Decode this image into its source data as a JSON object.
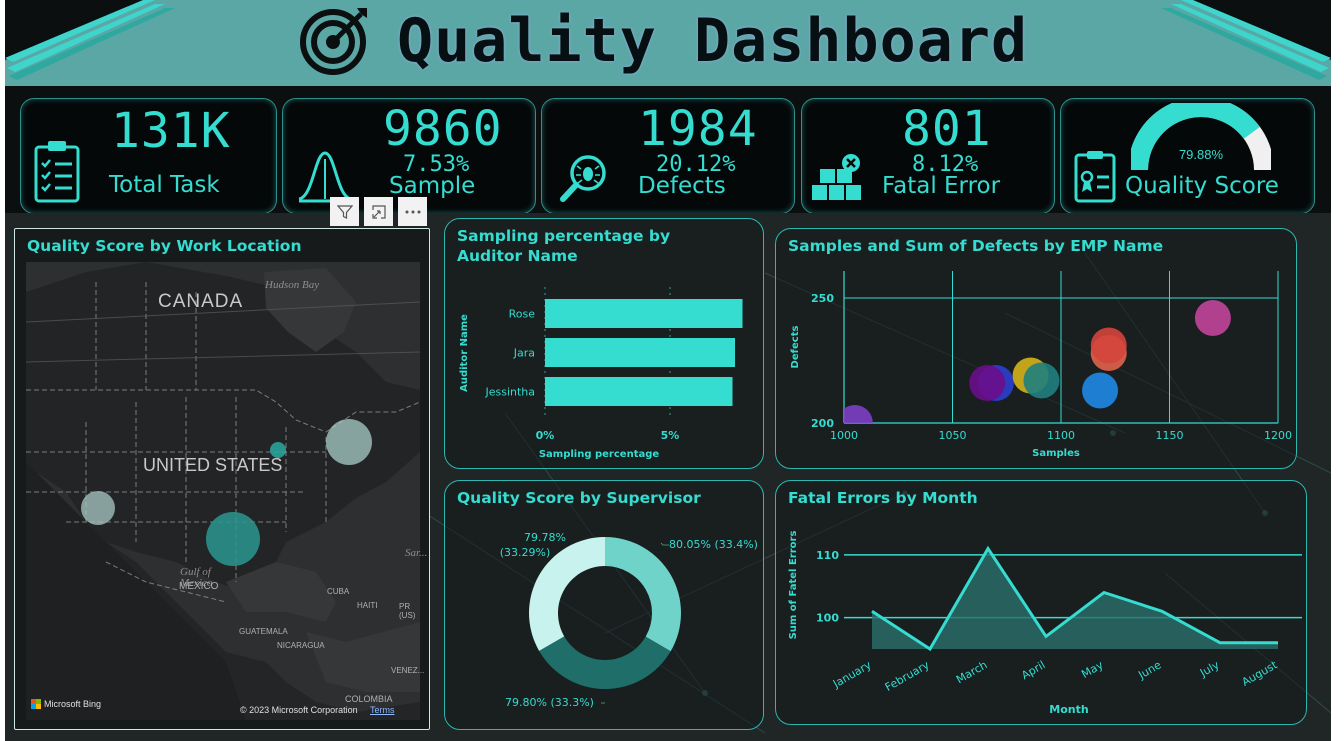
{
  "header": {
    "title": "Quality Dashboard"
  },
  "kpis": [
    {
      "value": "131K",
      "label": "Total Task",
      "icon": "clipboard-checklist-icon"
    },
    {
      "value": "9860",
      "pct": "7.53%",
      "label": "Sample",
      "icon": "bell-curve-icon"
    },
    {
      "value": "1984",
      "pct": "20.12%",
      "label": "Defects",
      "icon": "bug-magnifier-icon"
    },
    {
      "value": "801",
      "pct": "8.12%",
      "label": "Fatal Error",
      "icon": "boxes-error-icon"
    },
    {
      "pct": "79.88%",
      "label": "Quality Score",
      "icon": "certificate-clipboard-icon",
      "gauge_fill": 0.7988
    }
  ],
  "visual_toolbar": {
    "filter_icon": "filter-icon",
    "focus_icon": "focus-mode-icon",
    "more_icon": "more-options-icon"
  },
  "map": {
    "title": "Quality Score by Work Location",
    "labels": {
      "canada": "CANADA",
      "hudson": "Hudson Bay",
      "us": "UNITED STATES",
      "mexico": "MEXICO",
      "gulf": "Gulf of Mexico",
      "cuba": "CUBA",
      "haiti": "HAITI",
      "pr": "PR (US)",
      "guatemala": "GUATEMALA",
      "nicaragua": "NICARAGUA",
      "venezuela": "VENEZ...",
      "colombia": "COLOMBIA",
      "sar": "Sar..."
    },
    "bing": "Microsoft Bing",
    "copyright": "© 2023 Microsoft Corporation",
    "terms": "Terms"
  },
  "sampling": {
    "title_line1": "Sampling percentage by",
    "title_line2": "Auditor Name",
    "ylabel": "Auditor Name",
    "xlabel": "Sampling percentage",
    "ticks": [
      "0%",
      "5%"
    ]
  },
  "scatter": {
    "title": "Samples and Sum of Defects by EMP Name",
    "xlabel": "Samples",
    "ylabel": "Defects"
  },
  "donut": {
    "title": "Quality Score by Supervisor",
    "labels": [
      "80.05% (33.4%)",
      "79.80% (33.3%)",
      "79.78%",
      "(33.29%)"
    ]
  },
  "fatal": {
    "title": "Fatal Errors by Month",
    "xlabel": "Month",
    "ylabel": "Sum of Fatel Errors"
  },
  "chart_data": [
    {
      "type": "bar",
      "orientation": "horizontal",
      "categories": [
        "Rose",
        "Jara",
        "Jessintha"
      ],
      "values": [
        7.9,
        7.6,
        7.5
      ],
      "xlim": [
        0,
        10
      ],
      "xticks": [
        0,
        5
      ],
      "color": "#35dcd0"
    },
    {
      "type": "scatter",
      "xlim": [
        1000,
        1200
      ],
      "ylim": [
        200,
        250
      ],
      "xticks": [
        1000,
        1050,
        1100,
        1150,
        1200
      ],
      "yticks": [
        200,
        250
      ],
      "points": [
        {
          "x": 1005,
          "y": 200,
          "color": "#7b3fc4"
        },
        {
          "x": 1070,
          "y": 216,
          "color": "#2a3fd0"
        },
        {
          "x": 1066,
          "y": 216,
          "color": "#6a0d8a"
        },
        {
          "x": 1086,
          "y": 219,
          "color": "#d4b21a"
        },
        {
          "x": 1091,
          "y": 217,
          "color": "#1f7f7f"
        },
        {
          "x": 1118,
          "y": 213,
          "color": "#1e88e5"
        },
        {
          "x": 1122,
          "y": 228,
          "color": "#e2624a"
        },
        {
          "x": 1122,
          "y": 231,
          "color": "#d4453c"
        },
        {
          "x": 1170,
          "y": 242,
          "color": "#c2449a"
        }
      ]
    },
    {
      "type": "pie",
      "donut": true,
      "categories": [
        "80.05%",
        "79.80%",
        "79.78%"
      ],
      "values": [
        33.4,
        33.3,
        33.29
      ],
      "colors": [
        "#6fd3c9",
        "#1f6e69",
        "#c7f2ee"
      ]
    },
    {
      "type": "area",
      "categories": [
        "January",
        "February",
        "March",
        "April",
        "May",
        "June",
        "July",
        "August"
      ],
      "values": [
        101,
        95,
        111,
        97,
        104,
        101,
        96,
        96
      ],
      "yticks": [
        100,
        110
      ],
      "ylim": [
        95,
        113
      ],
      "color": "#35dcd0"
    }
  ]
}
